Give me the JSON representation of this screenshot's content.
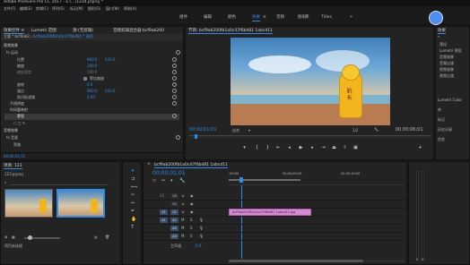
{
  "titlebar": {
    "title": "Adobe Premiere Pro CC 2017 - E:\\...\\1234.prproj *"
  },
  "menubar": {
    "items": [
      "文件(F)",
      "编辑(E)",
      "剪辑(C)",
      "序列(S)",
      "标记(M)",
      "图形(G)",
      "窗口(W)",
      "帮助(H)"
    ]
  },
  "workspaces": {
    "items": [
      "组件",
      "编辑",
      "颜色",
      "效果",
      "音频",
      "图形",
      "库",
      "Titles"
    ],
    "active_index": 3
  },
  "effect_controls": {
    "tabs": [
      "效果控件 ≡",
      "Lumetri 范围",
      "源:(无剪辑)",
      "音频剪辑混合器:bcf9ab200"
    ],
    "master_label": "主要 * bcf9ab2...",
    "clip_label": "bcf9ab200fb1a0c47f6bd81 * 蒸桥",
    "section_video": "视频效果",
    "motion_label": "fx 运动",
    "rows": [
      {
        "name": "位置",
        "v1": "960.0",
        "v2": "540.0"
      },
      {
        "name": "缩放",
        "v1": "100.0",
        "v2": ""
      },
      {
        "name": "缩放宽度",
        "v1": "100.0",
        "v2": ""
      },
      {
        "name": "等比缩放",
        "v1": "",
        "v2": ""
      },
      {
        "name": "旋转",
        "v1": "0.0",
        "v2": ""
      },
      {
        "name": "锚点",
        "v1": "960.0",
        "v2": "540.0"
      },
      {
        "name": "防闪烁滤镜",
        "v1": "0.00",
        "v2": ""
      },
      {
        "name": "不透明度",
        "v1": "",
        "v2": ""
      },
      {
        "name": "时间重映射",
        "v1": "",
        "v2": ""
      },
      {
        "name": "蒙版",
        "v1": "",
        "v2": ""
      }
    ],
    "section_audio": "音频效果",
    "volume_label": "fx 音量",
    "bypass_label": "旁路"
  },
  "project_panel": {
    "tab": "项目: 123",
    "filename": "123.prproj",
    "search_placeholder": "",
    "status": "项目未连接"
  },
  "program_monitor": {
    "tab": "节目: bcf9ab200fb1a0c47f6bd81 1abcd11",
    "timecode_left": "00;00;01;01",
    "timecode_right": "00;00;06;01",
    "fit": "适合",
    "fraction": "1/2",
    "image_caption": "航 长"
  },
  "effects_panel": {
    "tab": "效果",
    "items": [
      "预设",
      "Lumetri 预设",
      "音频效果",
      "音频过渡",
      "视频效果",
      "视频过渡"
    ],
    "sections": [
      "Lumetri Color",
      "库",
      "标记",
      "历史记录",
      "信息"
    ]
  },
  "timeline": {
    "tab": "bcf9ab200fb1a0c47f6bd81 1abcd11",
    "timecode": "00;00;01;01",
    "ruler_marks": [
      ":00;00",
      "00;00;05;00",
      "00;00;10;00"
    ],
    "video_tracks": [
      "V3",
      "V2",
      "V1"
    ],
    "audio_tracks": [
      "A1",
      "A2",
      "A3"
    ],
    "master": "主声道",
    "master_value": "0.0",
    "clip_label": "bcf9ab200fb1a0c47f6bd81 1abcd11.jpg",
    "clip_color": "#d88ad6"
  }
}
